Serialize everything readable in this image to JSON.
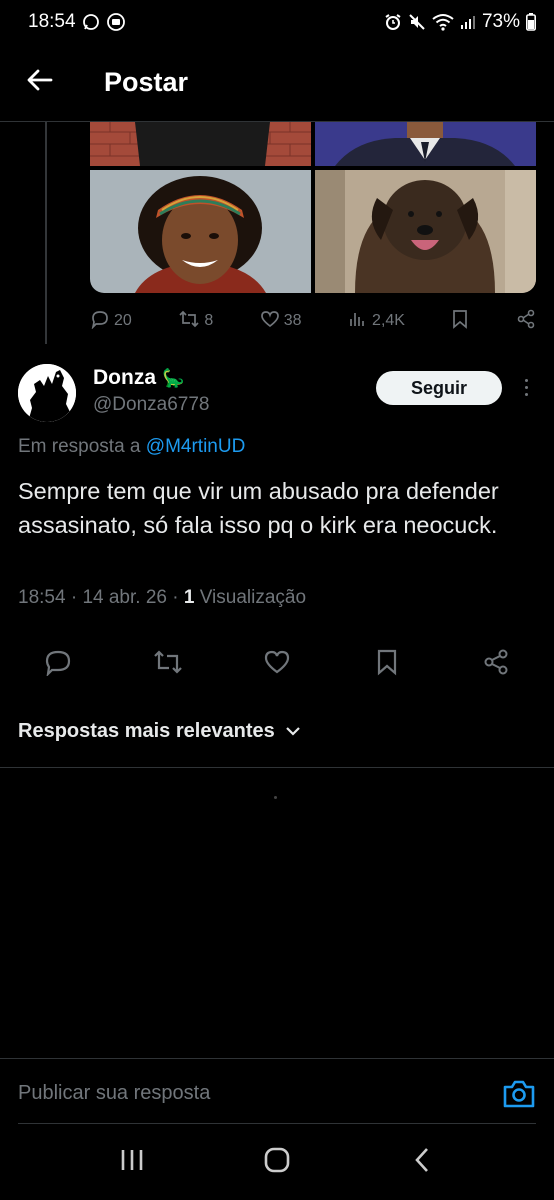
{
  "status_bar": {
    "time": "18:54",
    "battery": "73%",
    "left_icons": [
      "messenger-icon",
      "camera-notification-icon"
    ],
    "right_icons": [
      "alarm-icon",
      "mute-icon",
      "wifi-icon",
      "signal-icon",
      "battery-icon"
    ]
  },
  "header": {
    "title": "Postar",
    "back_icon": "arrow-left-icon"
  },
  "parent_tweet": {
    "media_count": 4,
    "actions": {
      "replies": "20",
      "reposts": "8",
      "likes": "38",
      "views": "2,4K"
    }
  },
  "tweet": {
    "author_name": "Donza",
    "author_emoji": "🦕",
    "author_handle": "@Donza6778",
    "follow_label": "Seguir",
    "reply_prefix": "Em resposta a",
    "reply_handle": "@M4rtinUD",
    "text": "Sempre tem que vir um abusado pra defender assasinato, só fala isso pq o kirk era neocuck.",
    "time": "18:54",
    "date": "14 abr. 26",
    "views_count": "1",
    "views_label": "Visualização"
  },
  "sort": {
    "label": "Respostas mais relevantes"
  },
  "composer": {
    "placeholder": "Publicar sua resposta"
  },
  "colors": {
    "background": "#000000",
    "text": "#e7e9ea",
    "muted": "#71767b",
    "accent": "#1d9bf0",
    "border": "#2f3336"
  }
}
